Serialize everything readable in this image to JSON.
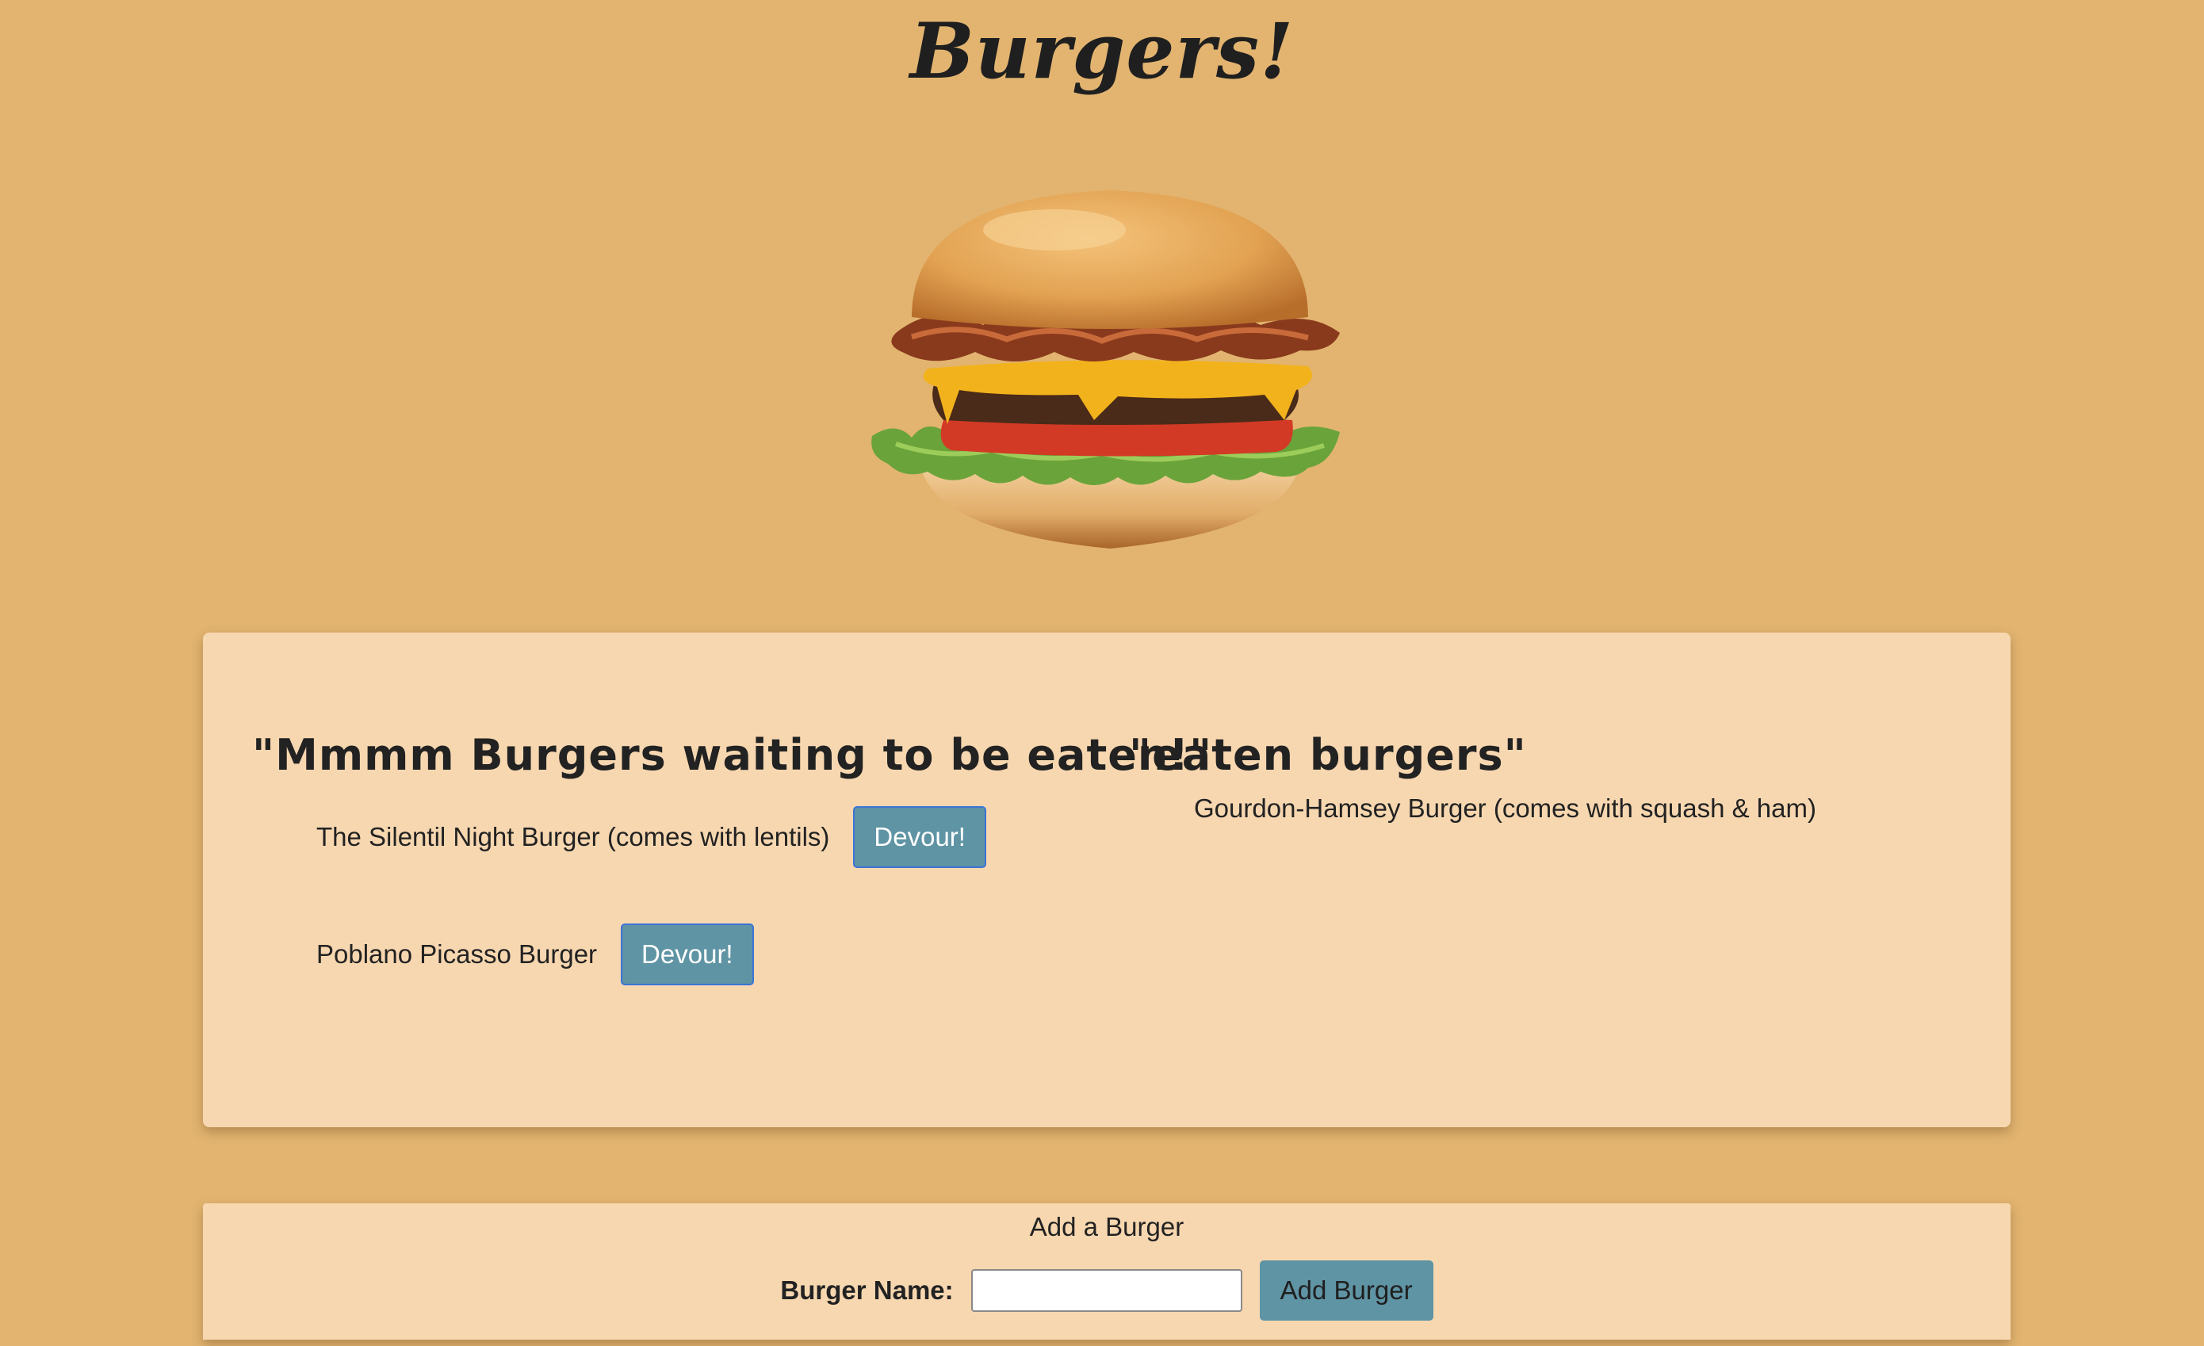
{
  "header": {
    "title": "Burgers!"
  },
  "hero": {
    "image_name": "burger-photo"
  },
  "lists": {
    "waiting_title": "\"Mmmm Burgers waiting to be eaten!\"",
    "eaten_title": "\"eaten burgers\"",
    "waiting": [
      {
        "name": "The Silentil Night Burger (comes with lentils)",
        "button_label": "Devour!"
      },
      {
        "name": "Poblano Picasso Burger",
        "button_label": "Devour!"
      }
    ],
    "eaten": [
      {
        "name": "Gourdon-Hamsey Burger (comes with squash & ham)"
      }
    ]
  },
  "add_form": {
    "title": "Add a Burger",
    "label": "Burger Name:",
    "input_value": "",
    "button_label": "Add Burger"
  },
  "colors": {
    "page_background": "#e2b470",
    "panel_background": "#f7d7b0",
    "button_background": "#5f94a4",
    "button_border": "#3b74d6"
  }
}
